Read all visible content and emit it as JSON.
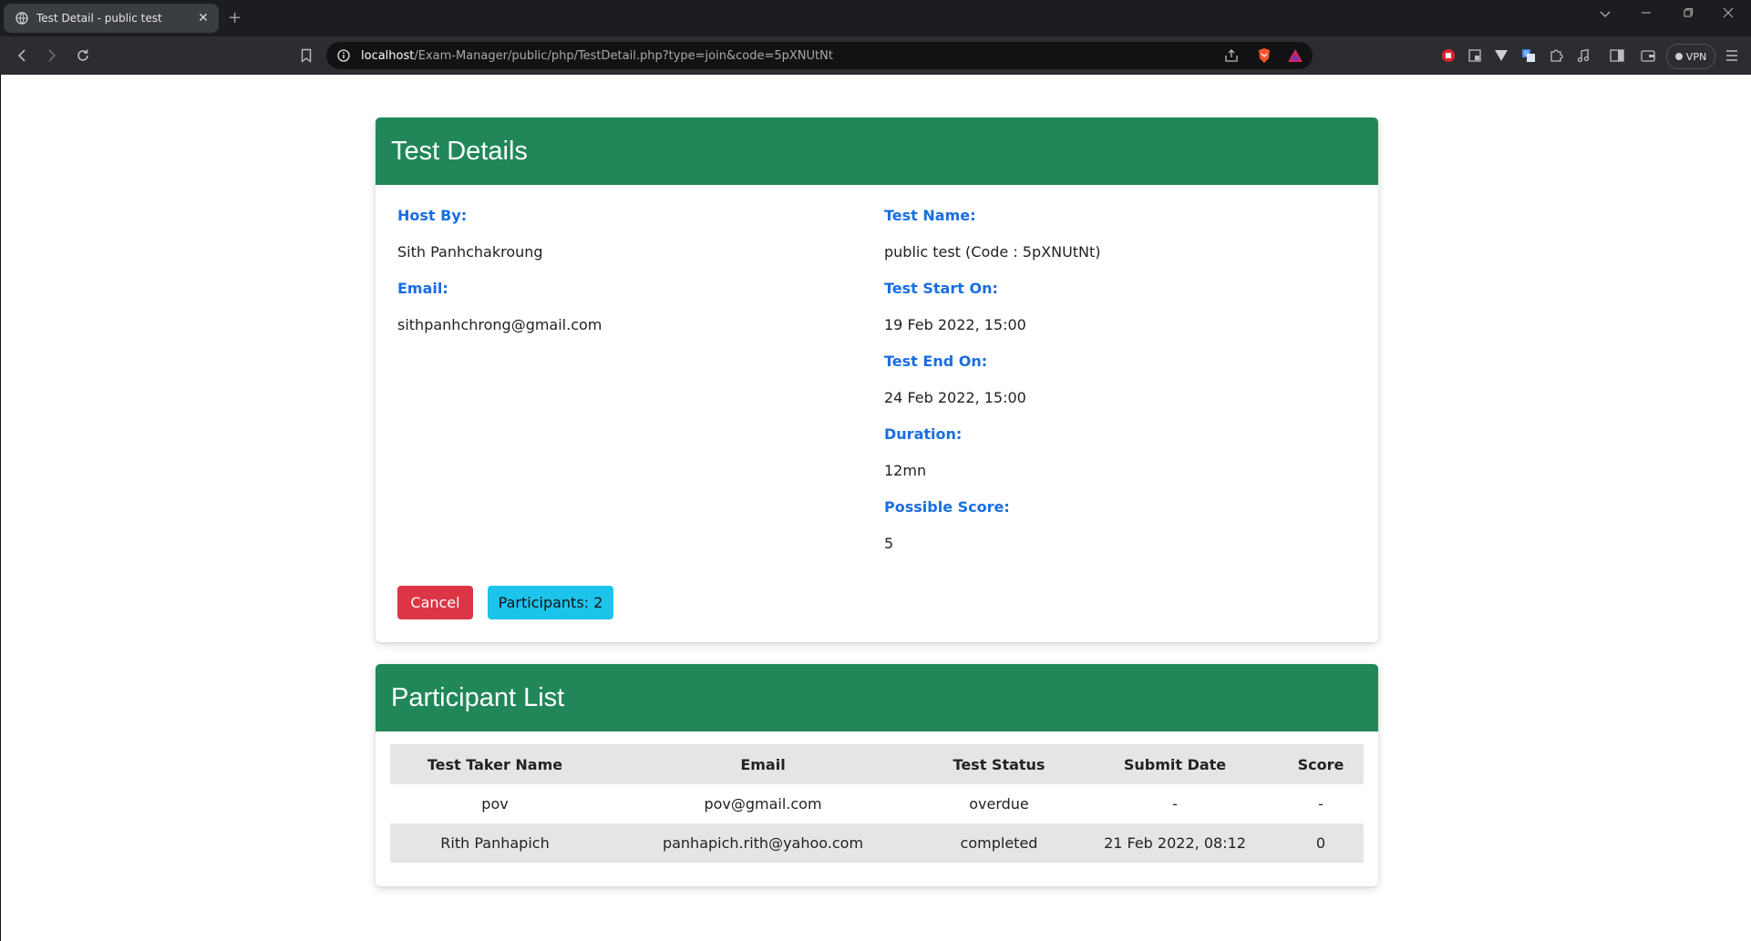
{
  "browser": {
    "tab_title": "Test Detail - public test",
    "tab_close": "✕",
    "new_tab": "+",
    "url_host": "localhost",
    "url_path": "/Exam-Manager/public/php/TestDetail.php?type=join&code=5pXNUtNt",
    "vpn_label": "VPN",
    "colors": {
      "tabbar": "#1b1d20",
      "toolbar": "#2b2d31",
      "omnibox": "#111214"
    }
  },
  "test_details": {
    "header": "Test Details",
    "host_label": "Host By:",
    "host_value": "Sith Panhchakroung",
    "email_label": "Email:",
    "email_value": "sithpanhchrong@gmail.com",
    "name_label": "Test Name:",
    "name_value": "public test (Code : 5pXNUtNt)",
    "start_label": "Test Start On:",
    "start_value": "19 Feb 2022, 15:00",
    "end_label": "Test End On:",
    "end_value": "24 Feb 2022, 15:00",
    "duration_label": "Duration:",
    "duration_value": "12mn",
    "score_label": "Possible Score:",
    "score_value": "5",
    "cancel_button": "Cancel",
    "participants_button": "Participants: 2"
  },
  "participant_list": {
    "header": "Participant List",
    "columns": [
      "Test Taker Name",
      "Email",
      "Test Status",
      "Submit Date",
      "Score"
    ],
    "rows": [
      [
        "pov",
        "pov@gmail.com",
        "overdue",
        "-",
        "-"
      ],
      [
        "Rith Panhapich",
        "panhapich.rith@yahoo.com",
        "completed",
        "21 Feb 2022, 08:12",
        "0"
      ]
    ]
  },
  "colors": {
    "header_green": "#218759",
    "label_blue": "#1a6ee0",
    "cancel_red": "#dc3545",
    "participants_cyan": "#1cc4ec",
    "table_stripe": "#e5e5e5"
  }
}
